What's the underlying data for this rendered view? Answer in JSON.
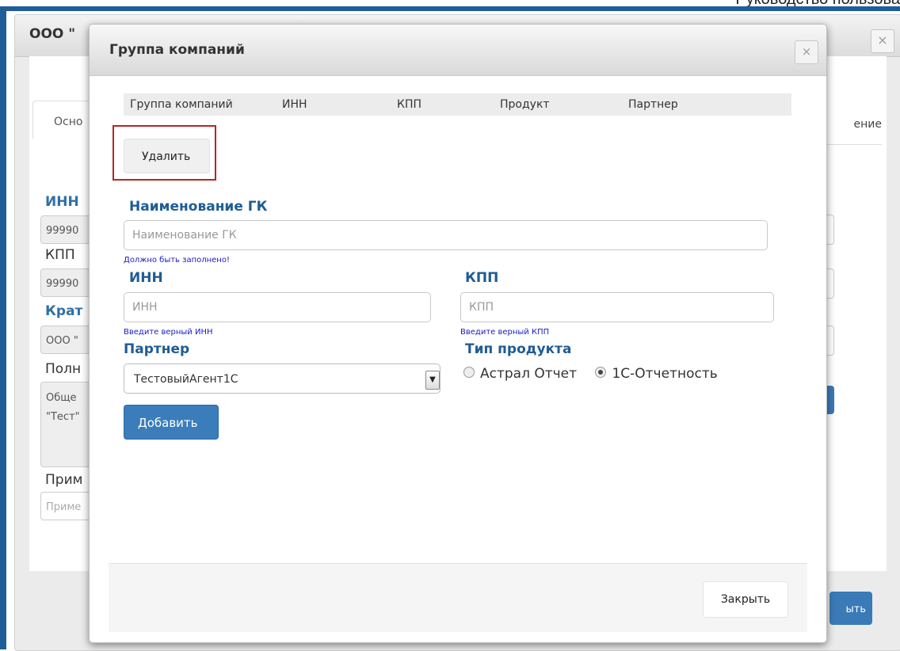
{
  "document": {
    "header_text": "Руководство пользова"
  },
  "background_form": {
    "title": "ООО \"",
    "close_icon": "×",
    "tab_left": "Осно",
    "tab_right": "ение",
    "labels": {
      "inn": "ИНН",
      "kpp": "КПП",
      "short_name": "Крат",
      "full_name": "Полн",
      "note": "Прим"
    },
    "values": {
      "inn": "99990",
      "kpp": "99990",
      "short_name": "ООО \"",
      "full_name_line1": "Обще",
      "full_name_line2": "\"Тест\"",
      "note_placeholder": "Приме"
    },
    "footer_button": "ыть"
  },
  "modal": {
    "title": "Группа компаний",
    "close_icon": "×",
    "grid_columns": [
      "Группа компаний",
      "ИНН",
      "КПП",
      "Продукт",
      "Партнер"
    ],
    "delete_button": "Удалить",
    "name_label": "Наименование ГК",
    "name_placeholder": "Наименование ГК",
    "name_hint": "Должно быть заполнено!",
    "inn_label": "ИНН",
    "inn_placeholder": "ИНН",
    "inn_hint": "Введите верный ИНН",
    "kpp_label": "КПП",
    "kpp_placeholder": "КПП",
    "kpp_hint": "Введите верный КПП",
    "partner_label": "Партнер",
    "partner_value": "ТестовыйАгент1С",
    "product_type_label": "Тип продукта",
    "product_options": [
      {
        "label": "Астрал Отчет",
        "checked": false
      },
      {
        "label": "1С-Отчетность",
        "checked": true
      }
    ],
    "add_button": "Добавить",
    "footer_close_button": "Закрыть"
  },
  "colors": {
    "accent_blue": "#3b7dbb",
    "label_blue": "#1f5c94",
    "hint_blue": "#1a1ac8",
    "highlight_red": "#b42727",
    "frame_blue": "#1f5d99"
  }
}
